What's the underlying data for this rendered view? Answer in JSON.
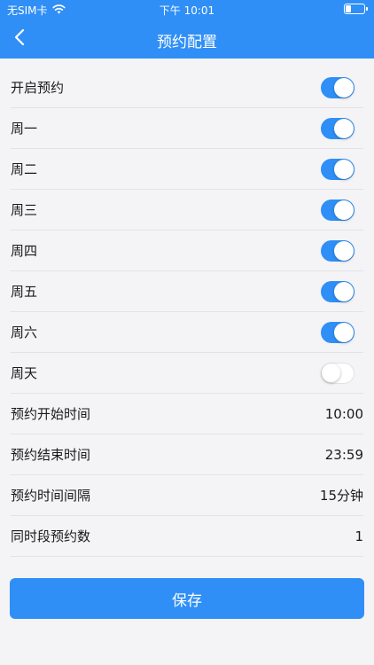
{
  "status_bar": {
    "carrier": "无SIM卡",
    "time": "下午 10:01"
  },
  "nav": {
    "title": "预约配置"
  },
  "settings": {
    "enable": {
      "label": "开启预约",
      "on": true
    },
    "days": [
      {
        "label": "周一",
        "on": true
      },
      {
        "label": "周二",
        "on": true
      },
      {
        "label": "周三",
        "on": true
      },
      {
        "label": "周四",
        "on": true
      },
      {
        "label": "周五",
        "on": true
      },
      {
        "label": "周六",
        "on": true
      },
      {
        "label": "周天",
        "on": false
      }
    ],
    "start_time": {
      "label": "预约开始时间",
      "value": "10:00"
    },
    "end_time": {
      "label": "预约结束时间",
      "value": "23:59"
    },
    "interval": {
      "label": "预约时间间隔",
      "value": "15分钟"
    },
    "concurrent": {
      "label": "同时段预约数",
      "value": "1"
    }
  },
  "save_button": {
    "label": "保存"
  },
  "colors": {
    "accent": "#2f8ff6",
    "background": "#f4f4f6",
    "divider": "#e3e3e6"
  },
  "icons": {
    "back": "chevron-left-icon",
    "wifi": "wifi-icon",
    "battery": "battery-icon"
  }
}
